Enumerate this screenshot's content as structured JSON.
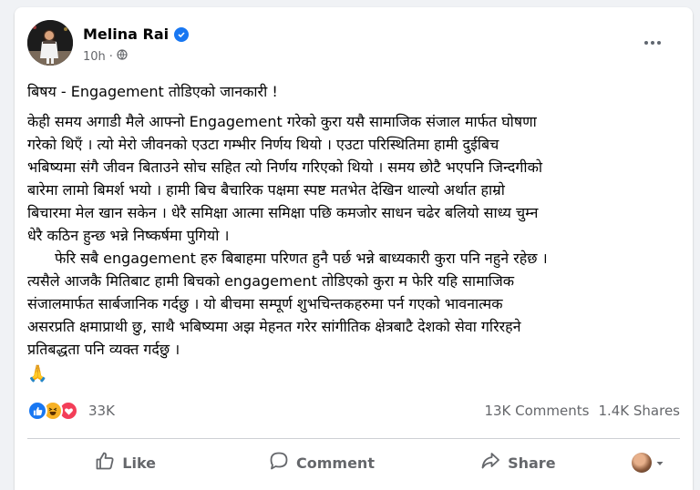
{
  "post": {
    "author": "Melina Rai",
    "time": "10h",
    "subject": "बिषय - Engagement तोडिएको जानकारी !",
    "paragraph1": [
      "केही समय अगाडी मैले आफ्नो Engagement गरेको कुरा यसै सामाजिक संजाल मार्फत घोषणा",
      "गरेको थिएँ । त्यो मेरो जीवनको एउटा गम्भीर निर्णय थियो । एउटा  परिस्थितिमा हामी दुईबिच",
      "भबिष्यमा संगै जीवन बिताउने सोच सहित त्यो निर्णय गरिएको थियो । समय छोटै भएपनि  जिन्दगीको",
      "बारेमा लामो बिमर्श भयो । हामी बिच बैचारिक पक्षमा स्पष्ट मतभेत देखिन थाल्यो अर्थात हाम्रो",
      "बिचारमा मेल खान सकेन । धेरै समिक्षा आत्मा समिक्षा पछि कमजोर साधन चढेर बलियो साध्य चुम्न",
      "धेरै कठिन हुन्छ भन्ने निष्कर्षमा पुगियो ।"
    ],
    "paragraph2": [
      "फेरि सबै engagement हरु बिबाहमा परिणत हुनै पर्छ भन्ने बाध्यकारी कुरा पनि नहुने रहेछ ।",
      "त्यसैले आजकै मितिबाट हामी बिचको engagement  तोडिएको कुरा म  फेरि यहि सामाजिक",
      "संजालमार्फत सार्बजानिक गर्दछु । यो बीचमा सम्पूर्ण शुभचिन्तकहरुमा पर्न गएको भावनात्मक",
      "असरप्रति क्षमाप्राथी छु, साथै भबिष्यमा अझ मेहनत गरेर सांगीतिक क्षेत्रबाटै देशको सेवा गरिरहने",
      "प्रतिबद्धता पनि व्यक्त गर्दछु ।"
    ],
    "emoji": "🙏"
  },
  "stats": {
    "reactions_count": "33K",
    "comments": "13K Comments",
    "shares": "1.4K Shares"
  },
  "actions": {
    "like": "Like",
    "comment": "Comment",
    "share": "Share"
  },
  "icons": {
    "verified": "verified-badge-icon",
    "privacy": "globe-icon",
    "more": "more-options-icon",
    "like": "thumbs-up-icon",
    "comment": "speech-bubble-icon",
    "share": "share-arrow-icon"
  },
  "colors": {
    "brand_blue": "#1877f2",
    "haha_yellow": "#f7b125",
    "love_red": "#f33e58",
    "secondary_text": "#65676b"
  }
}
